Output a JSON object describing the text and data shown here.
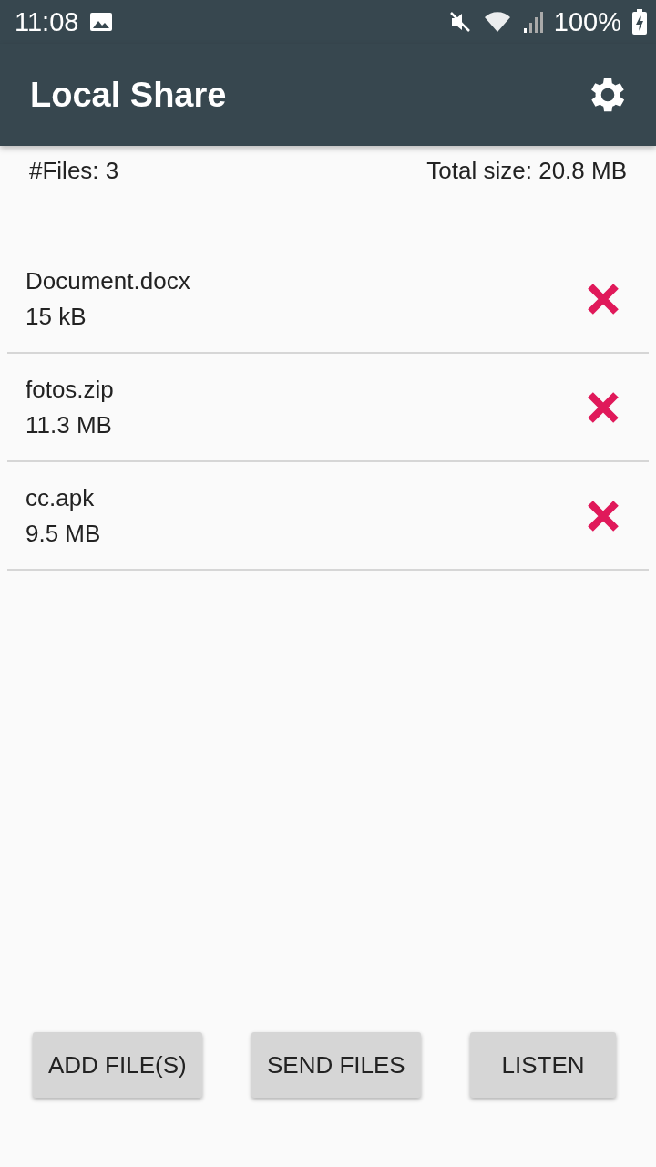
{
  "status_bar": {
    "time": "11:08",
    "battery": "100%"
  },
  "app_bar": {
    "title": "Local Share"
  },
  "summary": {
    "count": "#Files: 3",
    "total": "Total size: 20.8 MB"
  },
  "files": [
    {
      "name": "Document.docx",
      "size": "15 kB"
    },
    {
      "name": "fotos.zip",
      "size": "11.3 MB"
    },
    {
      "name": "cc.apk",
      "size": "9.5 MB"
    }
  ],
  "buttons": [
    "ADD FILE(S)",
    "SEND FILES",
    "LISTEN"
  ]
}
